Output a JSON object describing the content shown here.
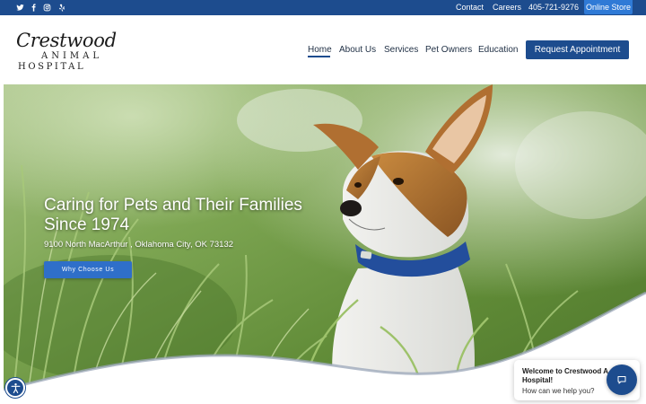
{
  "topbar": {
    "social": [
      {
        "name": "twitter-icon"
      },
      {
        "name": "facebook-icon"
      },
      {
        "name": "instagram-icon"
      },
      {
        "name": "yelp-icon"
      }
    ],
    "links": {
      "contact": "Contact",
      "careers": "Careers",
      "phone": "405-721-9276"
    },
    "store_label": "Online Store"
  },
  "header": {
    "logo": {
      "line1": "Crestwood",
      "line2": "ANIMAL",
      "line3": "HOSPITAL"
    },
    "nav": [
      {
        "label": "Home",
        "active": true
      },
      {
        "label": "About Us"
      },
      {
        "label": "Services"
      },
      {
        "label": "Pet Owners"
      },
      {
        "label": "Education"
      }
    ],
    "cta_label": "Request Appointment"
  },
  "hero": {
    "title_line1": "Caring for Pets and Their Families",
    "title_line2": "Since 1974",
    "address": "9100 North MacArthur , Oklahoma City, OK 73132",
    "button_label": "Why Choose Us"
  },
  "chat": {
    "title_line1": "Welcome to Crestwood A",
    "title_line2": "Hospital!",
    "subtitle": "How can we help you?"
  },
  "colors": {
    "brand_blue": "#1d4c8e",
    "accent_blue": "#2f7ad6",
    "grass_green": "#6f9a3e"
  },
  "icons": {
    "accessibility": "accessibility-icon",
    "chat": "chat-bubble-icon"
  }
}
